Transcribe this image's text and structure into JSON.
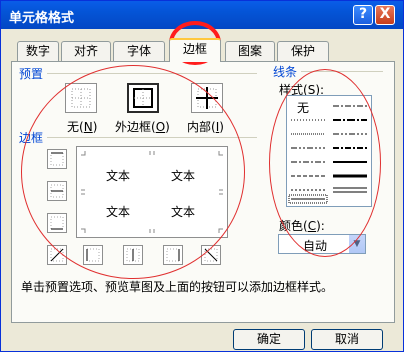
{
  "dialog": {
    "title": "单元格格式",
    "help_glyph": "?",
    "close_glyph": "X"
  },
  "tabs": [
    {
      "label": "数字"
    },
    {
      "label": "对齐"
    },
    {
      "label": "字体"
    },
    {
      "label": "边框",
      "active": true
    },
    {
      "label": "图案"
    },
    {
      "label": "保护"
    }
  ],
  "presets": {
    "group_label": "预置",
    "none": {
      "label": "无",
      "key": "N"
    },
    "outline": {
      "label": "外边框",
      "key": "O"
    },
    "inside": {
      "label": "内部",
      "key": "I"
    }
  },
  "border": {
    "group_label": "边框",
    "preview_texts": [
      "文本",
      "文本",
      "文本",
      "文本"
    ]
  },
  "line": {
    "group_label": "线条",
    "style_label": "样式",
    "style_key": "S",
    "none_label": "无",
    "color_label": "颜色",
    "color_key": "C",
    "color_value": "自动"
  },
  "hint_text": "单击预置选项、预览草图及上面的按钮可以添加边框样式。",
  "buttons": {
    "ok": "确定",
    "cancel": "取消"
  },
  "colors": {
    "title_bar": "#0454d6",
    "group_label": "#0046d5",
    "annotation": "#e03030",
    "active_tab_highlight": "#ffc83c"
  }
}
